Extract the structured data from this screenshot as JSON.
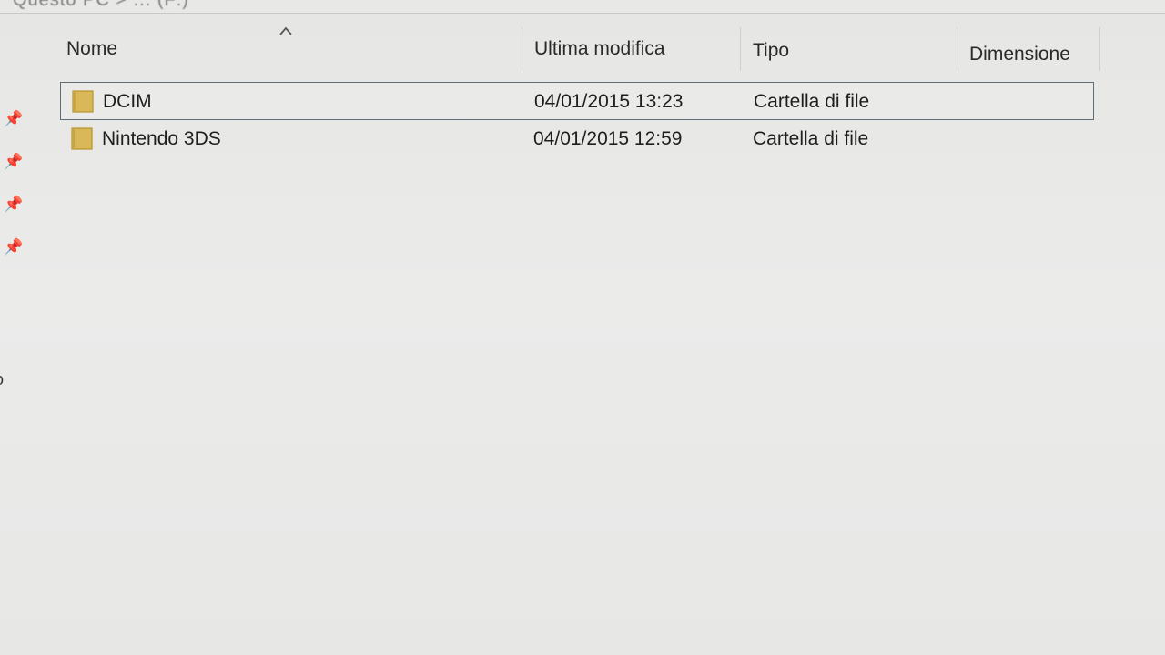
{
  "breadcrumb": {
    "text": "Questo PC > ... (F:)"
  },
  "nav_pane": {
    "pins": [
      {
        "icon": "pin-icon"
      },
      {
        "icon": "pin-icon"
      },
      {
        "icon": "pin-icon"
      },
      {
        "icon": "pin-icon"
      }
    ],
    "partial_label": "o"
  },
  "columns": {
    "name": "Nome",
    "modified": "Ultima modifica",
    "type": "Tipo",
    "size": "Dimensione",
    "sort_icon": "chevron-up-icon"
  },
  "files": [
    {
      "name": "DCIM",
      "modified": "04/01/2015 13:23",
      "type": "Cartella di file",
      "size": "",
      "selected": true,
      "icon": "folder-icon"
    },
    {
      "name": "Nintendo 3DS",
      "modified": "04/01/2015 12:59",
      "type": "Cartella di file",
      "size": "",
      "selected": false,
      "icon": "folder-icon"
    }
  ],
  "colors": {
    "folder_fill": "#d9b85a",
    "folder_edge": "#b8922f",
    "selection_border": "#5f6b75",
    "background": "#e9e9e7"
  }
}
